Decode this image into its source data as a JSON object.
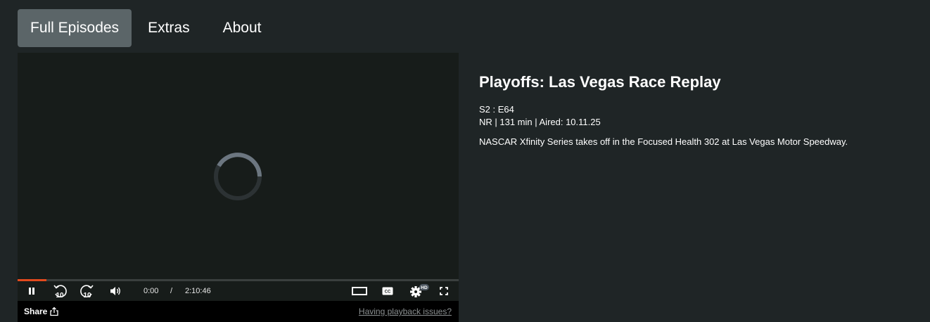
{
  "tabs": [
    {
      "label": "Full Episodes",
      "active": true
    },
    {
      "label": "Extras",
      "active": false
    },
    {
      "label": "About",
      "active": false
    }
  ],
  "player": {
    "state": "loading",
    "current_time": "0:00",
    "separator": "/",
    "duration": "2:10:46",
    "progress_fraction": 0.065,
    "quality_badge": "HD",
    "skip_back_seconds": "10",
    "skip_forward_seconds": "10",
    "accent_color": "#e24a1d"
  },
  "footer": {
    "share_label": "Share",
    "issues_link": "Having playback issues?"
  },
  "episode": {
    "title": "Playoffs: Las Vegas Race Replay",
    "season_episode": "S2 : E64",
    "meta": "NR | 131 min | Aired: 10.11.25",
    "description": "NASCAR Xfinity Series takes off in the Focused Health 302 at Las Vegas Motor Speedway."
  }
}
